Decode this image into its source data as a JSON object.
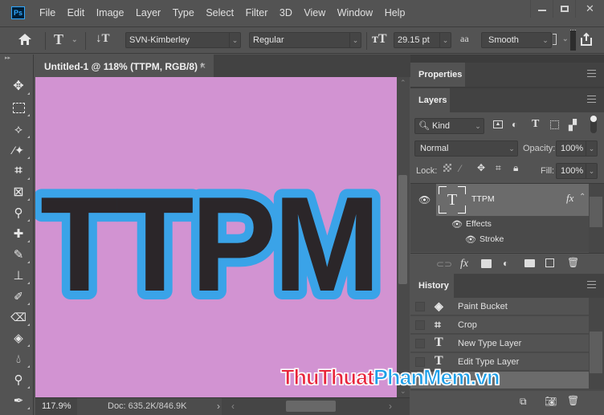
{
  "app": {
    "logo": "Ps",
    "window_controls": [
      "minimize",
      "maximize",
      "close"
    ]
  },
  "menu": [
    "File",
    "Edit",
    "Image",
    "Layer",
    "Type",
    "Select",
    "Filter",
    "3D",
    "View",
    "Window",
    "Help"
  ],
  "options_bar": {
    "home_icon": "home-icon",
    "type_tool_icon": "T",
    "orientation_icon": "↓T",
    "font_family": "SVN-Kimberley",
    "font_style": "Regular",
    "font_size_icon": "тT",
    "font_size": "29.15 pt",
    "antialias_icon": "aa",
    "antialias": "Smooth"
  },
  "document": {
    "tab_title": "Untitled-1 @ 118% (TTPM, RGB/8) *",
    "close": "×",
    "canvas_text": "TTPM",
    "canvas_bg": "#d293d2",
    "text_fill": "#2b2629",
    "stroke_color": "#3aa3e8",
    "zoom": "117.9%",
    "doc_size": "Doc: 635.2K/846.9K"
  },
  "tools": [
    "move",
    "marquee",
    "lasso",
    "magic-wand",
    "crop",
    "frame",
    "eyedropper",
    "healing",
    "brush",
    "stamp",
    "history-brush",
    "eraser",
    "paint-bucket",
    "blur",
    "dodge",
    "pen"
  ],
  "properties_panel": {
    "title": "Properties"
  },
  "layers_panel": {
    "title": "Layers",
    "filter": "Kind",
    "blend_mode": "Normal",
    "opacity_label": "Opacity:",
    "opacity": "100%",
    "lock_label": "Lock:",
    "fill_label": "Fill:",
    "fill": "100%",
    "layers": [
      {
        "name": "TTPM",
        "type": "text",
        "fx": "fx",
        "effects_label": "Effects",
        "effects": [
          "Stroke"
        ]
      }
    ]
  },
  "history_panel": {
    "title": "History",
    "items": [
      {
        "icon": "paint-bucket",
        "label": "Paint Bucket"
      },
      {
        "icon": "crop",
        "label": "Crop"
      },
      {
        "icon": "type",
        "label": "New Type Layer"
      },
      {
        "icon": "type",
        "label": "Edit Type Layer"
      },
      {
        "icon": "",
        "label": ""
      }
    ]
  },
  "watermark": {
    "part1": "ThuThuat",
    "part2": "PhanMem",
    "part3": ".vn",
    "color1": "#e8253c",
    "color2": "#1e9fe8"
  }
}
